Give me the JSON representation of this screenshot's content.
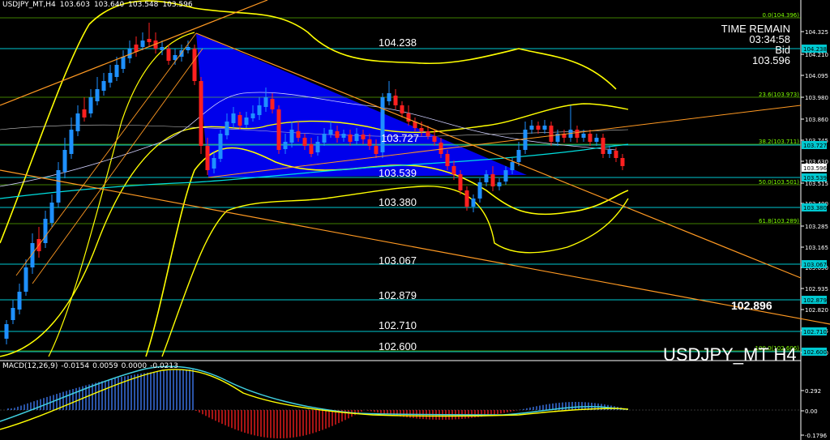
{
  "header": {
    "symbol_tf": "USDJPY_MT,H4",
    "open": "103.603",
    "high": "103.640",
    "low": "103.548",
    "close": "103.596"
  },
  "macd_header": {
    "name": "MACD(12,26,9)",
    "v1": "-0.0154",
    "v2": "0.0059",
    "v3": "0.0000",
    "v4": "-0.0213"
  },
  "info_box": {
    "line1": "TIME REMAIN",
    "line2": "03:34:58",
    "line3": "Bid",
    "line4": "103.596"
  },
  "watermark": "USDJPY_MT H4",
  "trendline_price": "102.896",
  "level_labels": [
    "104.238",
    "103.727",
    "103.539",
    "103.380",
    "103.067",
    "102.879",
    "102.710",
    "102.600"
  ],
  "price_axis": {
    "ticks": [
      "104.325",
      "104.210",
      "104.095",
      "103.980",
      "103.860",
      "103.745",
      "103.630",
      "103.515",
      "103.400",
      "103.285",
      "103.165",
      "103.050",
      "102.935",
      "102.820",
      "102.705",
      "102.590"
    ],
    "tags": [
      {
        "text": "104.238",
        "color": "#00c8d0"
      },
      {
        "text": "103.727",
        "color": "#00c8d0"
      },
      {
        "text": "103.596",
        "color": "#000000"
      },
      {
        "text": "103.539",
        "color": "#00c8d0"
      },
      {
        "text": "103.380",
        "color": "#00c8d0"
      },
      {
        "text": "103.067",
        "color": "#00c8d0"
      },
      {
        "text": "102.879",
        "color": "#00c8d0"
      },
      {
        "text": "102.710",
        "color": "#00c8d0"
      },
      {
        "text": "102.600",
        "color": "#00c8d0"
      }
    ]
  },
  "macd_axis": {
    "ticks": [
      "0.292",
      "0.00",
      "-0.1796"
    ]
  },
  "fibonacci": [
    {
      "label": "0.0(104.396)"
    },
    {
      "label": "23.6(103.973)"
    },
    {
      "label": "38.2(103.711)"
    },
    {
      "label": "50.0(103.501)"
    },
    {
      "label": "61.8(103.289)"
    },
    {
      "label": "100.0(102.606)"
    }
  ],
  "colors": {
    "background": "#000000",
    "bull_candle": "#1e90ff",
    "bear_candle": "#ff2020",
    "level_line": "#00c8d0",
    "bollinger": "#ffff00",
    "triangle_fill": "#0000ff",
    "trendline": "#ff9922",
    "macd_line": "#40d0e0",
    "signal_line": "#ffff00",
    "fib": "#7fff00"
  }
}
